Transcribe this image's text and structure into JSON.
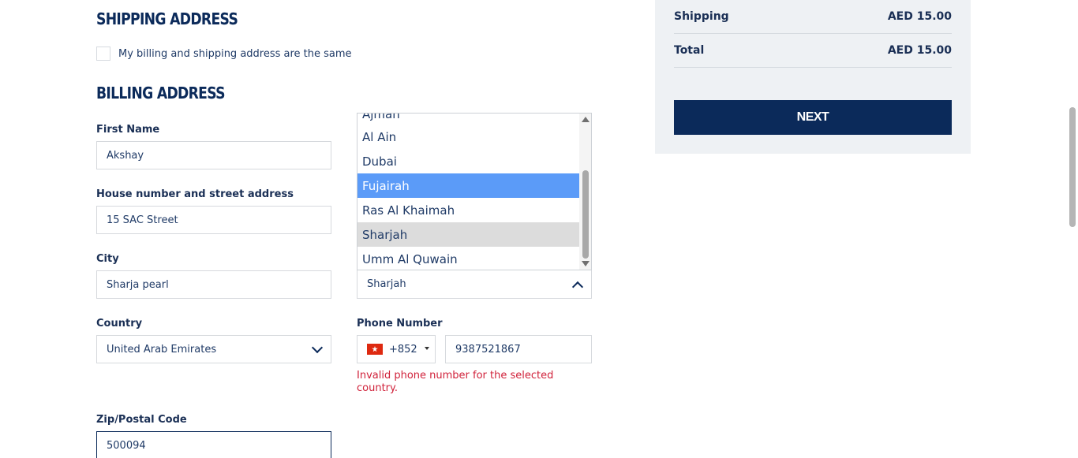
{
  "shipping": {
    "heading": "SHIPPING ADDRESS",
    "same_address_label": "My billing and shipping address are the same"
  },
  "billing": {
    "heading": "BILLING ADDRESS",
    "first_name_label": "First Name",
    "first_name_value": "Akshay",
    "street_label": "House number and street address",
    "street_value": "15 SAC Street",
    "city_label": "City",
    "city_value": "Sharja pearl",
    "country_label": "Country",
    "country_value": "United Arab Emirates",
    "zip_label": "Zip/Postal Code",
    "zip_value": "500094",
    "region_value": "Sharjah",
    "phone_label": "Phone Number",
    "phone_code": "+852",
    "phone_value": "9387521867",
    "phone_error": "Invalid phone number for the selected country."
  },
  "region_options": [
    "Ajman",
    "Al Ain",
    "Dubai",
    "Fujairah",
    "Ras Al Khaimah",
    "Sharjah",
    "Umm Al Quwain"
  ],
  "summary": {
    "shipping_label": "Shipping",
    "shipping_value": "AED 15.00",
    "total_label": "Total",
    "total_value": "AED 15.00",
    "next_label": "NEXT"
  },
  "colors": {
    "brand_navy": "#0b2a5a",
    "selected_option": "#5b9bf8",
    "error": "#d0213a"
  }
}
